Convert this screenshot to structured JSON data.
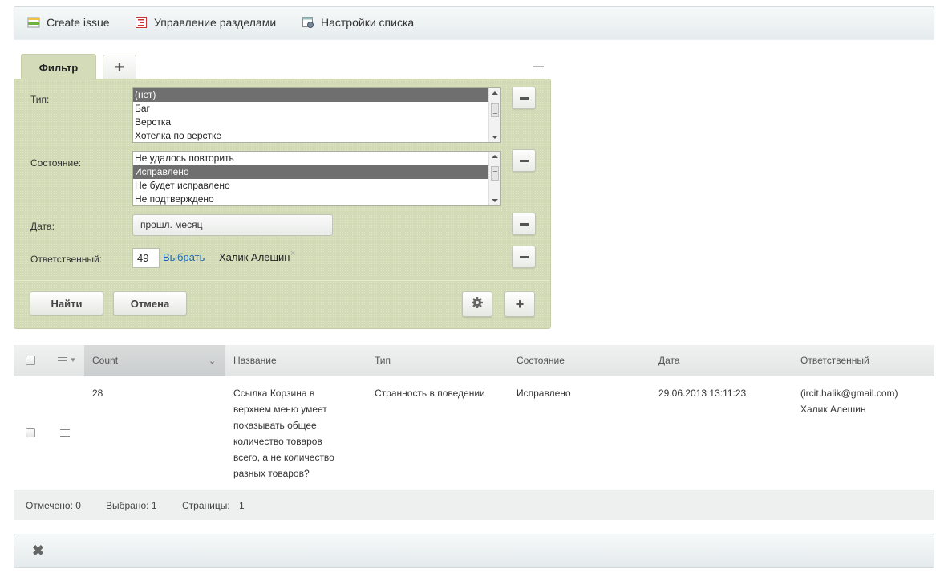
{
  "toolbar": {
    "create_issue": "Create issue",
    "manage_sections": "Управление разделами",
    "list_settings": "Настройки списка"
  },
  "filter": {
    "tab_label": "Фильтр",
    "add_tab": "+",
    "type_label": "Тип:",
    "type_options": [
      "(нет)",
      "Баг",
      "Верстка",
      "Хотелка по верстке"
    ],
    "state_label": "Состояние:",
    "state_options": [
      "Не удалось повторить",
      "Исправлено",
      "Не будет исправлено",
      "Не подтверждено"
    ],
    "date_label": "Дата:",
    "date_value": "прошл. месяц",
    "responsible_label": "Ответственный:",
    "responsible_id": "49",
    "choose_link": "Выбрать",
    "responsible_name": "Халик Алешин",
    "remove_x": "×",
    "find_button": "Найти",
    "cancel_button": "Отмена",
    "add_button": "+"
  },
  "grid": {
    "columns": [
      "Count",
      "Название",
      "Тип",
      "Состояние",
      "Дата",
      "Ответственный"
    ],
    "row": {
      "count": "28",
      "name_lines": [
        "Ссылка Корзина в",
        "верхнем меню умеет",
        "показывать общее",
        "количество товаров",
        "всего, а не количество",
        "разных товаров?"
      ],
      "type": "Странность в поведении",
      "state": "Исправлено",
      "date": "29.06.2013 13:11:23",
      "responsible_email": "(ircit.halik@gmail.com)",
      "responsible_name": "Халик Алешин"
    },
    "footer": {
      "marked": "Отмечено: 0",
      "selected": "Выбрано: 1",
      "pages_label": "Страницы:",
      "pages_value": "1"
    }
  },
  "bottom": {
    "close": "✖"
  }
}
